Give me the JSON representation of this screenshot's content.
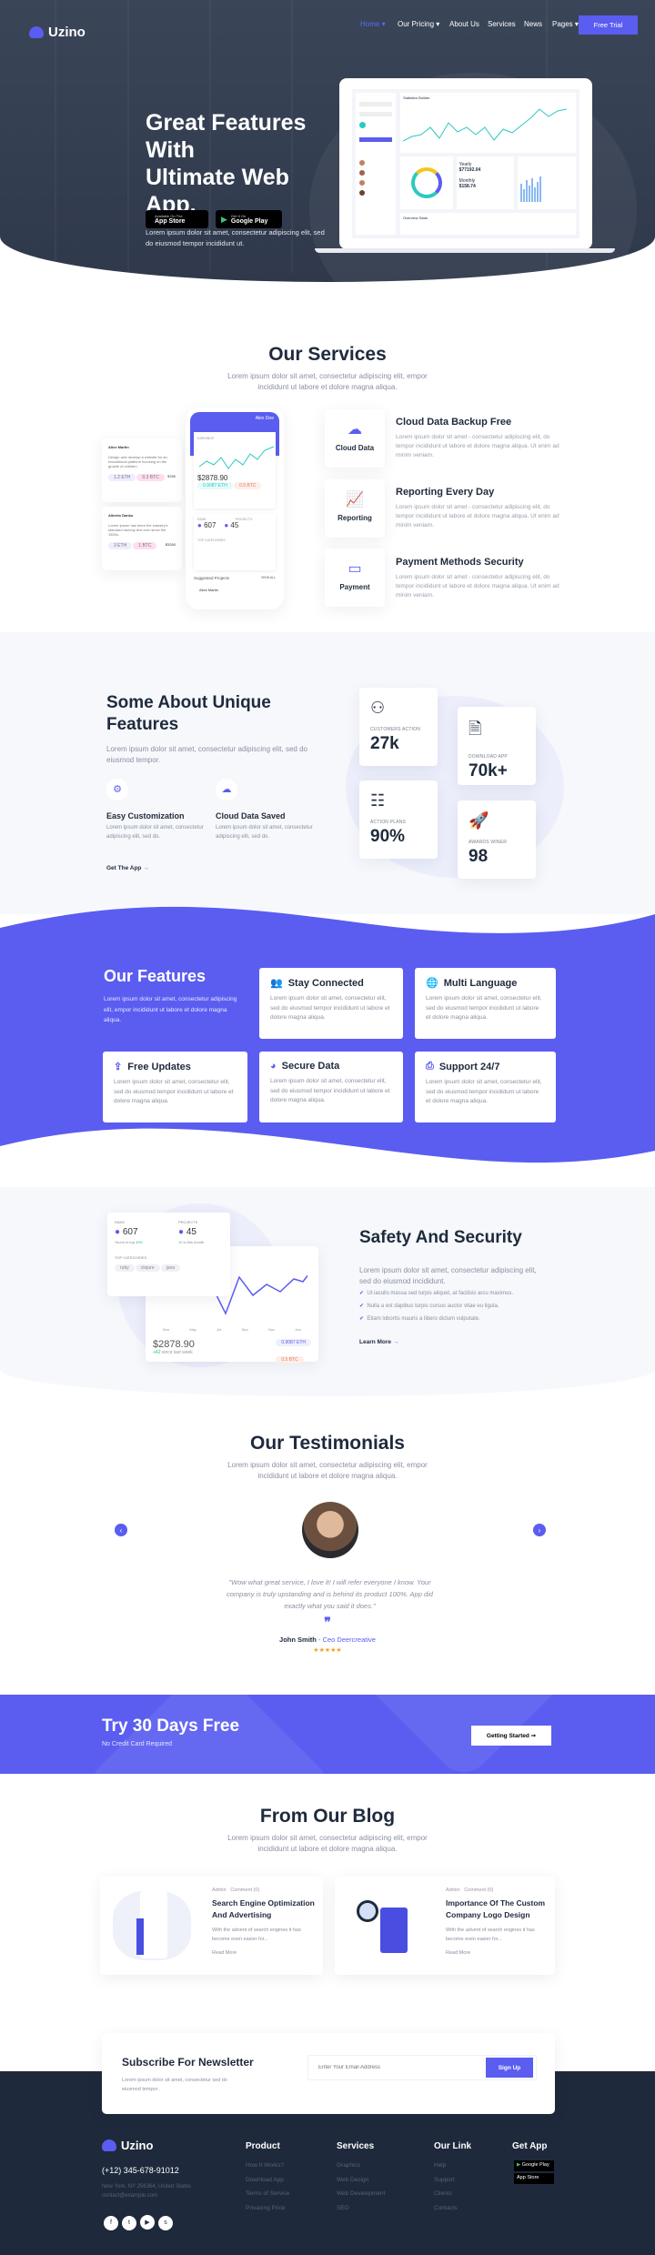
{
  "brand": {
    "name": "Uzino",
    "accent": "#5a5df0",
    "dark": "#1f2a3c"
  },
  "nav": {
    "items": [
      "Home",
      "Our Pricing",
      "About Us",
      "Services",
      "News",
      "Pages"
    ],
    "cta": "Free Trial"
  },
  "hero": {
    "title_lines": [
      "Great Features",
      "With",
      "Ultimate Web",
      "App."
    ],
    "subtitle": "Lorem ipsum dolor sit amet, consectetur adipiscing elit, sed do eiusmod tempor incididunt ut.",
    "app_store": {
      "small": "Available On The",
      "big": "App Store"
    },
    "google_play": {
      "small": "Get It On",
      "big": "Google Play"
    },
    "dashboard": {
      "title": "Statistics Builder",
      "yearly": "$77192.04",
      "monthly": "$158.74",
      "overview": "Overview Stats"
    }
  },
  "services": {
    "title": "Our Services",
    "subtitle": "Lorem ipsum dolor sit amet, consectetur adipiscing elit, empor incididunt ut labore et dolore magna aliqua.",
    "items": [
      {
        "box": "Cloud Data",
        "icon": "cloud-upload-icon",
        "title": "Cloud Data Backup Free",
        "text": "Lorem ipsum dolor sit amet - consectetur adipiscing elit, do tempor incididunt ut labore et dolore magna aliqua. Ut enim ad minim veniam."
      },
      {
        "box": "Reporting",
        "icon": "presentation-chart-icon",
        "title": "Reporting Every Day",
        "text": "Lorem ipsum dolor sit amet - consectetur adipiscing elit, do tempor incididunt ut labore et dolore magna aliqua. Ut enim ad minim veniam."
      },
      {
        "box": "Payment",
        "icon": "credit-card-icon",
        "title": "Payment Methods Security",
        "text": "Lorem ipsum dolor sit amet - consectetur adipiscing elit, do tempor incididunt ut labore et dolore magna aliqua. Ut enim ad minim veniam."
      }
    ],
    "mock": {
      "user": "Alex Doe",
      "earnings": "EARNINGS",
      "amount": "$2878.90",
      "eth": "0.9087 ETH",
      "btc": "0.5 BTC",
      "rank_label": "RANK",
      "rank": "607",
      "projects_label": "PROJECTS",
      "projects": "45",
      "top_categories": "TOP CATEGORIES",
      "suggested": "Suggested Projects",
      "view_all": "VIEW ALL",
      "cards": [
        {
          "name": "Alice Martin",
          "text": "Design and develop a website for an educational platform focusing on the growth of children.",
          "a": "1.2 ETH",
          "b": "0.3 BTC",
          "price": "$780"
        },
        {
          "name": "Alberto Danko",
          "text": "Lorem Ipsum has been the industry's standard dummy text ever since the 1500s.",
          "a": "3 ETH",
          "b": "1 BTC",
          "price": "$3260"
        }
      ],
      "suggested_name": "Alice Martin"
    }
  },
  "unique": {
    "title": "Some About Unique Features",
    "subtitle": "Lorem ipsum dolor sit amet, consectetur adipiscing elit, sed do eiusmod tempor.",
    "features": [
      {
        "title": "Easy Customization",
        "text": "Lorem ipsum dolor sit amet, consectetur adipiscing elit, sed do.",
        "icon": "gears-icon"
      },
      {
        "title": "Cloud Data Saved",
        "text": "Lorem ipsum dolor sit amet, consectetur adipiscing elit, sed do.",
        "icon": "cloud-upload-icon"
      }
    ],
    "link": "Get The App",
    "stats": [
      {
        "label": "CUSTOMERS ACTION",
        "value": "27k",
        "icon": "team-icon"
      },
      {
        "label": "DOWNLOAD APP",
        "value": "70k+",
        "icon": "file-download-icon"
      },
      {
        "label": "ACTION PLANS",
        "value": "90%",
        "icon": "clipboard-icon"
      },
      {
        "label": "AWARDS WINER",
        "value": "98",
        "icon": "rocket-icon"
      }
    ]
  },
  "features": {
    "title": "Our Features",
    "subtitle": "Lorem ipsum dolor sit amet, consectetur adipiscing elit, empor incididunt ut labore et dolore magna aliqua.",
    "items": [
      {
        "title": "Stay Connected",
        "icon": "users-icon",
        "text": "Lorem ipsum dolor sit amet, consectetur elit, sed do eiusmod tempor incididunt ut labore et dolore magna aliqua."
      },
      {
        "title": "Multi Language",
        "icon": "globe-icon",
        "text": "Lorem ipsum dolor sit amet, consectetur elit, sed do eiusmod tempor incididunt ut labore et dolore magna aliqua."
      },
      {
        "title": "Free Updates",
        "icon": "upload-icon",
        "text": "Lorem ipsum dolor sit amet, consectetur elit, sed do eiusmod tempor incididunt ut labore et dolore magna aliqua."
      },
      {
        "title": "Secure Data",
        "icon": "shield-icon",
        "text": "Lorem ipsum dolor sit amet, consectetur elit, sed do eiusmod tempor incididunt ut labore et dolore magna aliqua."
      },
      {
        "title": "Support 24/7",
        "icon": "printer-icon",
        "text": "Lorem ipsum dolor sit amet, consectetur elit, sed do eiusmod tempor incididunt ut labore et dolore magna aliqua."
      }
    ]
  },
  "safety": {
    "title": "Safety And Security",
    "subtitle": "Lorem ipsum dolor sit amet, consectetur adipiscing elit, sed do eiusmod incididunt.",
    "list": [
      "Ut iaculis massa sed turpis aliquet, at facilisis arcu maximus.",
      "Nulla a est dapibus turpis cursus auctor vitae eu ligula.",
      "Etiam lobortis mauris a libero dictum vulputate."
    ],
    "link": "Learn More",
    "mock": {
      "rank_label": "RANK",
      "rank": "607",
      "rank_note": "You're in top",
      "rank_pct": "40%",
      "projects_label": "PROJECTS",
      "projects": "45",
      "projects_note_num": "10",
      "projects_note": "in this month",
      "top_categories": "TOP CATEGORIES",
      "tags": [
        "ruby",
        "clojure",
        "java"
      ],
      "amount": "$2878.90",
      "change": "+42",
      "change_note": "since last week",
      "eth": "0.9087 ETH",
      "btc": "0.5 BTC",
      "months": [
        "Mar",
        "May",
        "Jul",
        "Sep",
        "Nov",
        "Jan"
      ]
    }
  },
  "testimonials": {
    "title": "Our Testimonials",
    "subtitle": "Lorem ipsum dolor sit amet, consectetur adipiscing elit, empor incididunt ut labore et dolore magna aliqua.",
    "quote": "\"Wow what great service, I love it! I will refer everyone I know. Your company is truly upstanding and is behind its product 100%. App did exactly what you said it does.\"",
    "name": "John Smith",
    "role": "- Ceo Deercreative",
    "rating": 4.5,
    "star_color": "#f0a020"
  },
  "cta": {
    "title": "Try 30 Days Free",
    "subtitle": "No Credit Card Required",
    "button": "Getting Started"
  },
  "blog": {
    "title": "From Our Blog",
    "subtitle": "Lorem ipsum dolor sit amet, consectetur adipiscing elit, empor incididunt ut labore et dolore magna aliqua.",
    "posts": [
      {
        "author": "Admin",
        "comments": "Comment (0)",
        "title": "Search Engine Optimization And Advertising",
        "excerpt": "With the advent of search engines it has become even easier for...",
        "link": "Read More"
      },
      {
        "author": "Admin",
        "comments": "Comment (0)",
        "title": "Importance Of The Custom Company Logo Design",
        "excerpt": "With the advent of search engines it has become even easier for...",
        "link": "Read More"
      }
    ]
  },
  "newsletter": {
    "title": "Subscribe For Newsletter",
    "subtitle": "Lorem ipsum dolor sit amet, consectetur sed do eiusmod tempor .",
    "placeholder": "Enter Your Email Address",
    "button": "Sign Up"
  },
  "footer": {
    "phone": "(+12) 345-678-91012",
    "address": "New York, NY 256364, United States",
    "email": "contact@example.com",
    "columns": [
      {
        "title": "Product",
        "links": [
          "How It Works?",
          "Download App",
          "Terms of Service",
          "Privacing Price"
        ]
      },
      {
        "title": "Services",
        "links": [
          "Graphics",
          "Web Design",
          "Web Development",
          "SEO"
        ]
      },
      {
        "title": "Our Link",
        "links": [
          "Help",
          "Support",
          "Clients",
          "Contacts"
        ]
      }
    ],
    "get_app": "Get App",
    "google_play": "Google Play",
    "app_store": "App Store",
    "social": [
      "facebook-icon",
      "twitter-icon",
      "youtube-icon",
      "skype-icon"
    ]
  }
}
